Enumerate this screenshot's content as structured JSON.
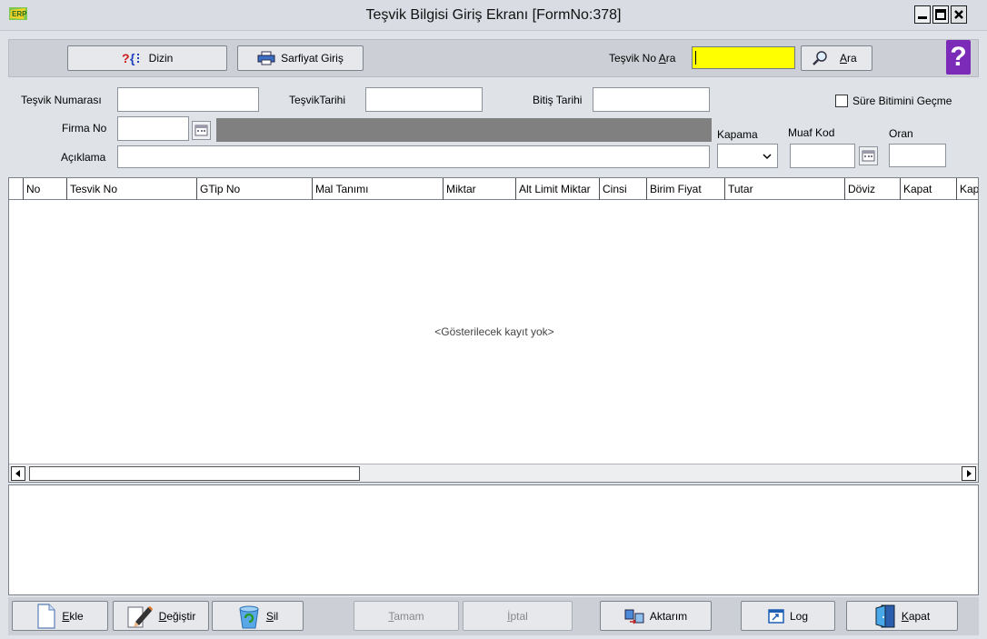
{
  "window": {
    "title": "Teşvik Bilgisi Giriş Ekranı [FormNo:378]",
    "icon": "app-logo-icon",
    "controls": [
      "minimize-icon",
      "maximize-icon",
      "close-icon"
    ]
  },
  "toolbar": {
    "dizin_label": "Dizin",
    "sarfiyat_label": "Sarfiyat Giriş",
    "search_label_prefix": "Teşvik No ",
    "search_label_accel": "A",
    "search_label_rest": "ra",
    "search_value": "",
    "ara_accel": "A",
    "ara_rest": "ra",
    "help_glyph": "?",
    "search_highlight_color": "#ffff00"
  },
  "form": {
    "tesvik_numarasi_label": "Teşvik Numarası",
    "tesvik_numarasi_value": "",
    "tesvik_tarihi_label": "TeşvikTarihi",
    "tesvik_tarihi_value": "",
    "bitis_tarihi_label": "Bitiş Tarihi",
    "bitis_tarihi_value": "",
    "sure_label": "Süre Bitimini Geçme",
    "sure_checked": false,
    "firma_no_label": "Firma No",
    "firma_no_value": "",
    "firma_name_value": "",
    "aciklama_label": "Açıklama",
    "aciklama_value": "",
    "kapama_label": "Kapama",
    "kapama_value": "",
    "muaf_kod_label": "Muaf Kod",
    "muaf_kod_value": "",
    "oran_label": "Oran",
    "oran_value": ""
  },
  "grid": {
    "columns": [
      "No",
      "Tesvik No",
      "GTip No",
      "Mal Tanımı",
      "Miktar",
      "Alt Limit Miktar",
      "Cinsi",
      "Birim Fiyat",
      "Tutar",
      "Döviz",
      "Kapat",
      "Kap"
    ],
    "rows": [],
    "empty_text": "<Gösterilecek kayıt yok>"
  },
  "bottom": {
    "ekle_accel": "E",
    "ekle_rest": "kle",
    "degistir_accel": "D",
    "degistir_rest": "eğiştir",
    "sil_accel": "S",
    "sil_rest": "il",
    "tamam_accel": "T",
    "tamam_rest": "amam",
    "iptal_accel": "İ",
    "iptal_rest": "ptal",
    "aktarim_label": "Aktarım",
    "log_label": "Log",
    "kapat_accel": "K",
    "kapat_rest": "apat"
  }
}
